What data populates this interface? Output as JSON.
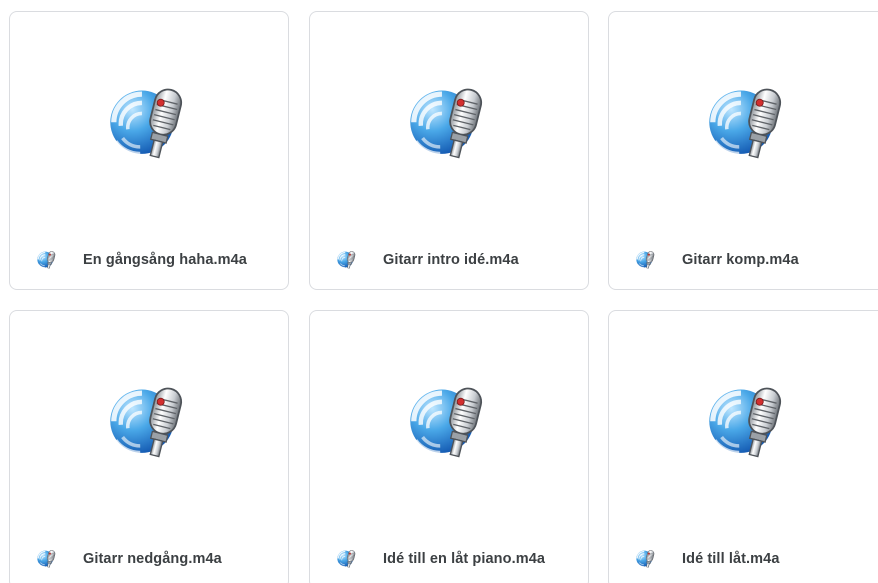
{
  "files": [
    {
      "name": "En gångsång haha.m4a",
      "icon": "voice-recorder-mic-icon"
    },
    {
      "name": "Gitarr intro idé.m4a",
      "icon": "voice-recorder-mic-icon"
    },
    {
      "name": "Gitarr komp.m4a",
      "icon": "voice-recorder-mic-icon"
    },
    {
      "name": "Gitarr nedgång.m4a",
      "icon": "voice-recorder-mic-icon"
    },
    {
      "name": "Idé till en låt piano.m4a",
      "icon": "voice-recorder-mic-icon"
    },
    {
      "name": "Idé till låt.m4a",
      "icon": "voice-recorder-mic-icon"
    }
  ],
  "colors": {
    "globe_light": "#7cc6f2",
    "globe_dark": "#1565c0",
    "border": "#dadce0",
    "text": "#3c4043"
  }
}
